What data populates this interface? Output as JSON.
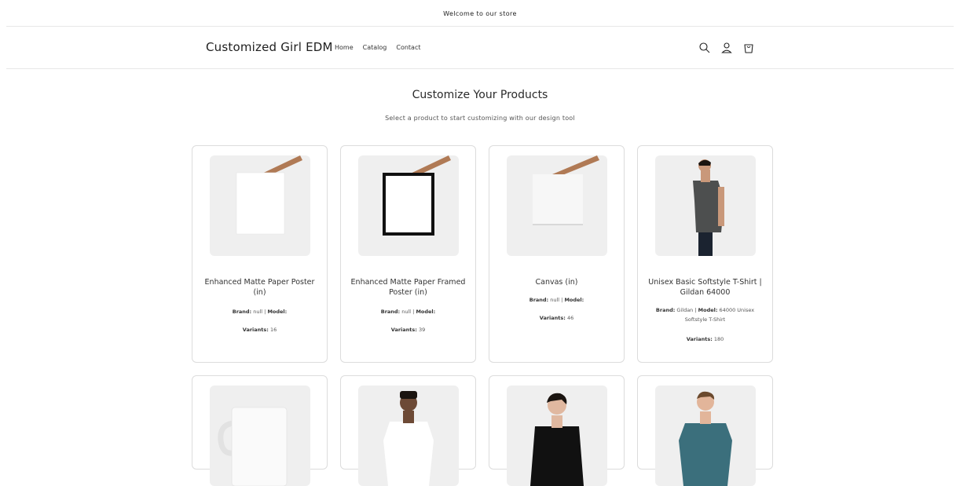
{
  "announcement": "Welcome to our store",
  "header": {
    "logo": "Customized Girl EDM",
    "nav": [
      "Home",
      "Catalog",
      "Contact"
    ]
  },
  "section": {
    "title": "Customize Your Products",
    "subtitle": "Select a product to start customizing with our design tool"
  },
  "labels": {
    "brand": "Brand:",
    "model": "Model:",
    "variants": "Variants:"
  },
  "products": [
    {
      "name": "Enhanced Matte Paper Poster (in)",
      "brand": "null",
      "model": "",
      "variants": "16",
      "image": "poster-held-icon"
    },
    {
      "name": "Enhanced Matte Paper Framed Poster (in)",
      "brand": "null",
      "model": "",
      "variants": "39",
      "image": "framed-poster-icon"
    },
    {
      "name": "Canvas (in)",
      "brand": "null",
      "model": "",
      "variants": "46",
      "image": "canvas-icon"
    },
    {
      "name": "Unisex Basic Softstyle T-Shirt | Gildan 64000",
      "brand": "Gildan",
      "model": "64000 Unisex Softstyle T-Shirt",
      "variants": "180",
      "image": "tshirt-model-icon"
    },
    {
      "image": "mug-icon"
    },
    {
      "image": "white-tshirt-model-icon"
    },
    {
      "image": "black-longsleeve-model-icon"
    },
    {
      "image": "teal-tshirt-model-icon"
    }
  ],
  "colors": {
    "border": "#dcdcdc",
    "imageBg": "#efefef",
    "text": "#121212"
  }
}
